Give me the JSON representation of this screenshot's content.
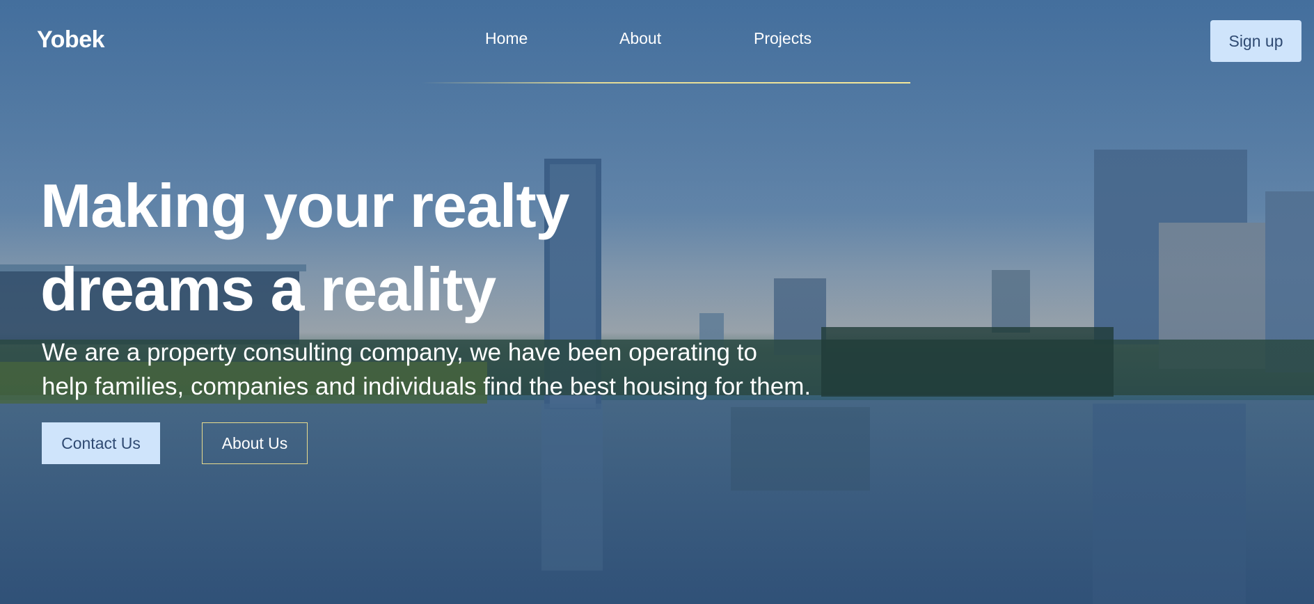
{
  "brand": {
    "name": "Yobek"
  },
  "nav": {
    "links": [
      {
        "label": "Home"
      },
      {
        "label": "About"
      },
      {
        "label": "Projects"
      }
    ],
    "signup_label": "Sign up"
  },
  "hero": {
    "headline_line1": "Making your realty",
    "headline_line2": "dreams a reality",
    "subtext_line1": "We are a property consulting company, we have been operating to",
    "subtext_line2": "help families, companies and individuals find the best housing for them.",
    "contact_label": "Contact Us",
    "about_label": "About Us"
  },
  "colors": {
    "accent_button": "#cfe4fb",
    "button_text": "#2f4a72",
    "underline": "#f5e89a"
  }
}
